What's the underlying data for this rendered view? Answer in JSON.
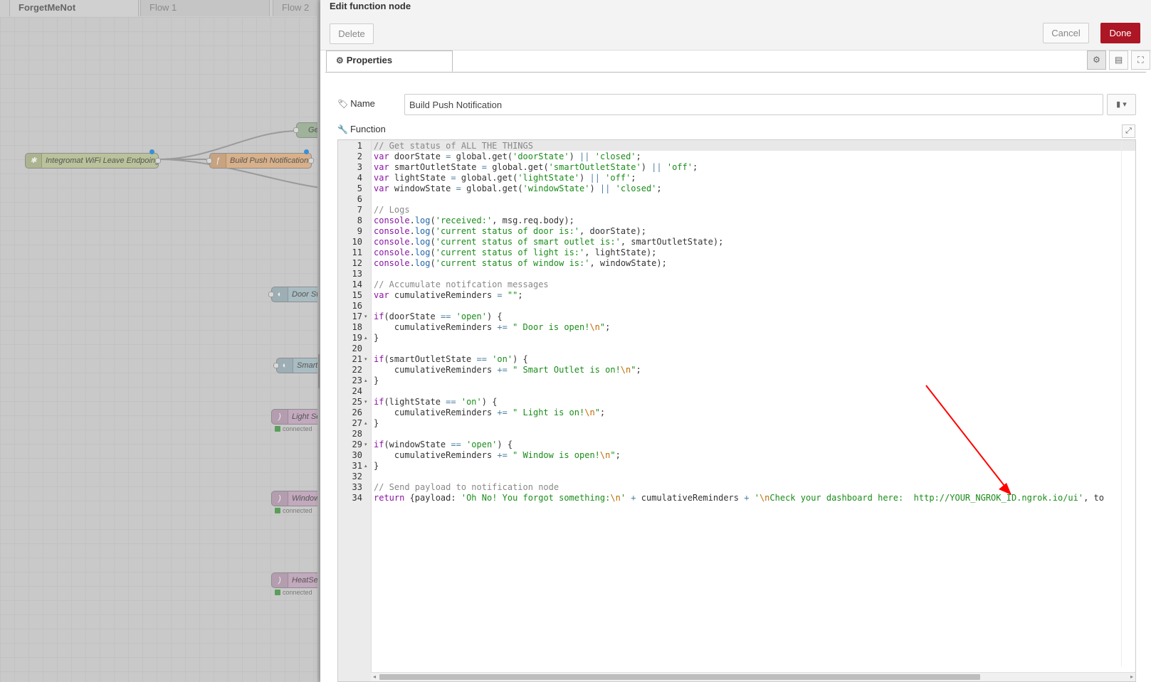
{
  "workspace": {
    "tabs": [
      "ForgetMeNot",
      "Flow 1",
      "Flow 2"
    ],
    "nodes": [
      {
        "label": "Integromat WiFi Leave Endpoing",
        "icon": "bridge-icon"
      },
      {
        "label": "Build Push Notification",
        "icon": "function-icon"
      },
      {
        "label": "Ge",
        "icon": ""
      },
      {
        "label": "Door Swi",
        "icon": "switch-icon"
      },
      {
        "label": "Smart O",
        "icon": "switch-icon"
      },
      {
        "label": "Light Sen",
        "icon": "sensor-icon"
      },
      {
        "label": "Window S",
        "icon": "sensor-icon"
      },
      {
        "label": "HeatSen",
        "icon": "sensor-icon"
      }
    ],
    "status_connected": "connected"
  },
  "tray": {
    "title": "Edit function node",
    "delete_label": "Delete",
    "cancel_label": "Cancel",
    "done_label": "Done",
    "tab_properties": "Properties",
    "name_label": "Name",
    "name_value": "Build Push Notification",
    "function_label": "Function"
  },
  "editor": {
    "line_numbers": [
      "1",
      "2",
      "3",
      "4",
      "5",
      "6",
      "7",
      "8",
      "9",
      "10",
      "11",
      "12",
      "13",
      "14",
      "15",
      "16",
      "17",
      "18",
      "19",
      "20",
      "21",
      "22",
      "23",
      "24",
      "25",
      "26",
      "27",
      "28",
      "29",
      "30",
      "31",
      "32",
      "33",
      "34"
    ],
    "code_lines": [
      "// Get status of ALL THE THINGS",
      "var doorState = global.get('doorState') || 'closed';",
      "var smartOutletState = global.get('smartOutletState') || 'off';",
      "var lightState = global.get('lightState') || 'off';",
      "var windowState = global.get('windowState') || 'closed';",
      "",
      "// Logs",
      "console.log('received:', msg.req.body);",
      "console.log('current status of door is:', doorState);",
      "console.log('current status of smart outlet is:', smartOutletState);",
      "console.log('current status of light is:', lightState);",
      "console.log('current status of window is:', windowState);",
      "",
      "// Accumulate notifcation messages",
      "var cumulativeReminders = \"\";",
      "",
      "if(doorState == 'open') {",
      "    cumulativeReminders += \" Door is open!\\n\";",
      "}",
      "",
      "if(smartOutletState == 'on') {",
      "    cumulativeReminders += \" Smart Outlet is on!\\n\";",
      "}",
      "",
      "if(lightState == 'on') {",
      "    cumulativeReminders += \" Light is on!\\n\";",
      "}",
      "",
      "if(windowState == 'open') {",
      "    cumulativeReminders += \" Window is open!\\n\";",
      "}",
      "",
      "// Send payload to notification node",
      "return {payload: 'Oh No! You forgot something:\\n' + cumulativeReminders + '\\nCheck your dashboard here:  http://YOUR_NGROK_ID.ngrok.io/ui', to"
    ]
  },
  "colors": {
    "primary_button": "#ad1625",
    "annotation_arrow": "#ff0000"
  }
}
